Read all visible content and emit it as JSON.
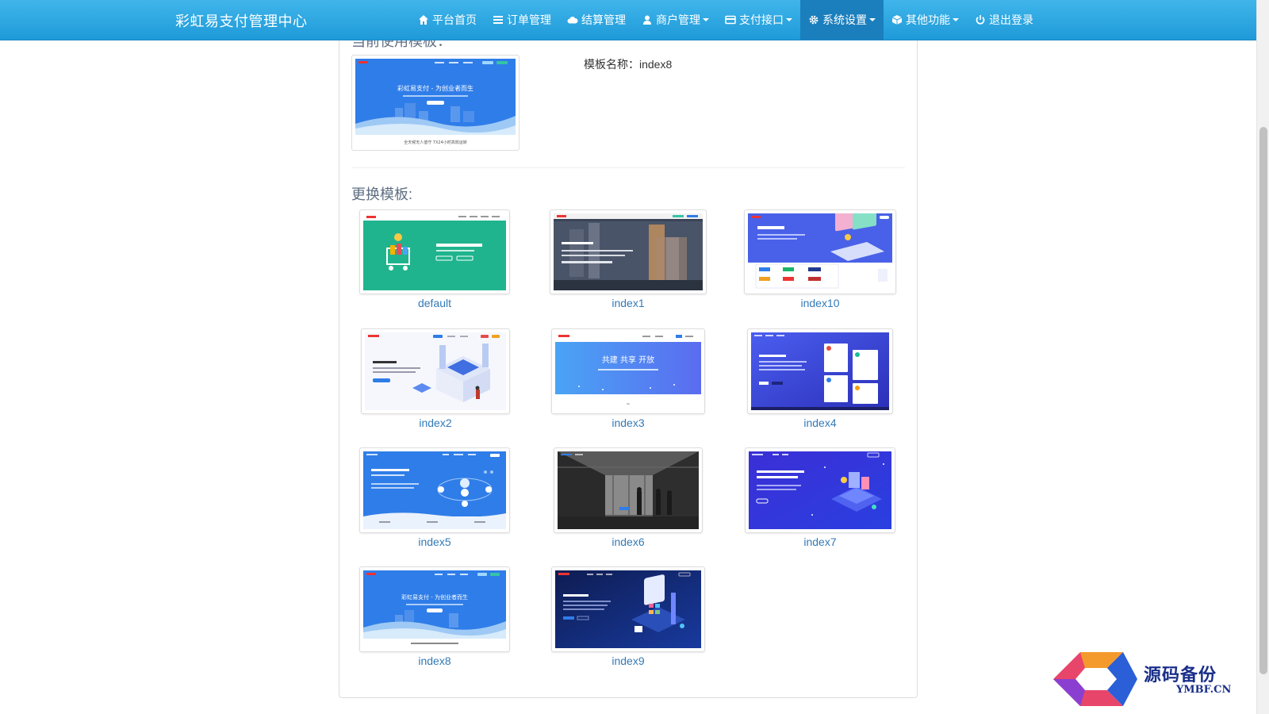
{
  "navbar": {
    "brand": "彩虹易支付管理中心",
    "items": [
      {
        "label": "平台首页",
        "icon": "home-icon",
        "dropdown": false,
        "active": false
      },
      {
        "label": "订单管理",
        "icon": "list-icon",
        "dropdown": false,
        "active": false
      },
      {
        "label": "结算管理",
        "icon": "cloud-icon",
        "dropdown": false,
        "active": false
      },
      {
        "label": "商户管理",
        "icon": "user-icon",
        "dropdown": true,
        "active": false
      },
      {
        "label": "支付接口",
        "icon": "credit-card-icon",
        "dropdown": true,
        "active": false
      },
      {
        "label": "系统设置",
        "icon": "gear-icon",
        "dropdown": true,
        "active": true
      },
      {
        "label": "其他功能",
        "icon": "cube-icon",
        "dropdown": true,
        "active": false
      },
      {
        "label": "退出登录",
        "icon": "power-icon",
        "dropdown": false,
        "active": false
      }
    ],
    "active_color": "#1b7fbd"
  },
  "current_template": {
    "section_title_cut": "当前使用模板：",
    "name_label": "模板名称：index8",
    "thumb_heading": "彩虹易支付 - 为创业者而生",
    "thumb_footer": "全天候无人值守 7X24小时高效运转"
  },
  "change_template": {
    "title": "更换模板:",
    "templates": [
      {
        "name": "default",
        "theme": "green-cart"
      },
      {
        "name": "index1",
        "theme": "dark-city"
      },
      {
        "name": "index10",
        "theme": "light-blue-laptop"
      },
      {
        "name": "index2",
        "theme": "white-isometric"
      },
      {
        "name": "index3",
        "theme": "blue-banner",
        "banner_text": "共建  共享  开放"
      },
      {
        "name": "index4",
        "theme": "violet-cards"
      },
      {
        "name": "index5",
        "theme": "blue-orbit"
      },
      {
        "name": "index6",
        "theme": "grayscale-office"
      },
      {
        "name": "index7",
        "theme": "indigo-isometric"
      },
      {
        "name": "index8",
        "theme": "blue-wave",
        "banner_text": "彩虹易支付 - 为创业者而生"
      },
      {
        "name": "index9",
        "theme": "navy-isometric"
      }
    ]
  },
  "watermark": {
    "logo_char": "码",
    "cn_text": "源码备份",
    "en_text": "YMBF.CN"
  },
  "colors": {
    "navbar": "#2aa4e0",
    "link": "#337ab7"
  }
}
